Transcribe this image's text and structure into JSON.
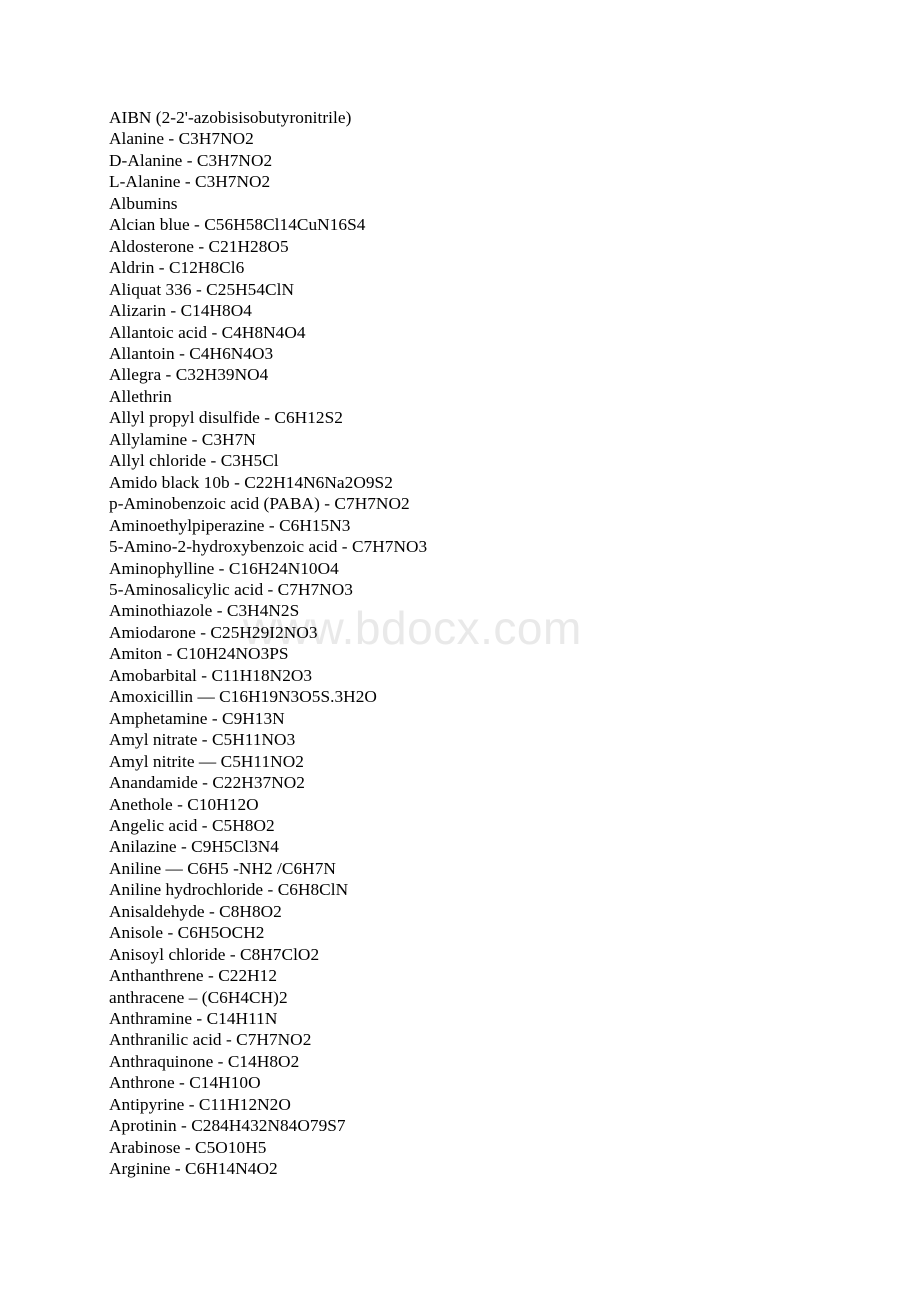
{
  "document": {
    "title": "Chemical compounds list - A entries",
    "background_color": "#ffffff",
    "text_color": "#000000"
  },
  "watermark": {
    "text": "www.bdocx.com",
    "color": "#e9e9e9"
  },
  "entries": [
    {
      "name": "AIBN",
      "formula": "",
      "separator": "",
      "text": "AIBN (2-2'-azobisisobutyronitrile)"
    },
    {
      "name": "Alanine",
      "formula": "C3H7NO2",
      "separator": "-",
      "text": "Alanine - C3H7NO2"
    },
    {
      "name": "D-Alanine",
      "formula": "C3H7NO2",
      "separator": "-",
      "text": "D-Alanine - C3H7NO2"
    },
    {
      "name": "L-Alanine",
      "formula": "C3H7NO2",
      "separator": "-",
      "text": "L-Alanine - C3H7NO2"
    },
    {
      "name": "Albumins",
      "formula": "",
      "separator": "",
      "text": "Albumins"
    },
    {
      "name": "Alcian blue",
      "formula": "C56H58Cl14CuN16S4",
      "separator": "-",
      "text": "Alcian blue - C56H58Cl14CuN16S4"
    },
    {
      "name": "Aldosterone",
      "formula": "C21H28O5",
      "separator": "-",
      "text": "Aldosterone - C21H28O5"
    },
    {
      "name": "Aldrin",
      "formula": "C12H8Cl6",
      "separator": "-",
      "text": "Aldrin - C12H8Cl6"
    },
    {
      "name": "Aliquat 336",
      "formula": "C25H54ClN",
      "separator": "-",
      "text": "Aliquat 336 - C25H54ClN"
    },
    {
      "name": "Alizarin",
      "formula": "C14H8O4",
      "separator": "-",
      "text": "Alizarin - C14H8O4"
    },
    {
      "name": "Allantoic acid",
      "formula": "C4H8N4O4",
      "separator": "-",
      "text": "Allantoic acid - C4H8N4O4"
    },
    {
      "name": "Allantoin",
      "formula": "C4H6N4O3",
      "separator": "-",
      "text": "Allantoin - C4H6N4O3"
    },
    {
      "name": "Allegra",
      "formula": "C32H39NO4",
      "separator": "-",
      "text": "Allegra - C32H39NO4"
    },
    {
      "name": "Allethrin",
      "formula": "",
      "separator": "",
      "text": "Allethrin"
    },
    {
      "name": "Allyl propyl disulfide",
      "formula": "C6H12S2",
      "separator": "-",
      "text": "Allyl propyl disulfide - C6H12S2"
    },
    {
      "name": "Allylamine",
      "formula": "C3H7N",
      "separator": "-",
      "text": "Allylamine - C3H7N"
    },
    {
      "name": "Allyl chloride",
      "formula": "C3H5Cl",
      "separator": "-",
      "text": "Allyl chloride - C3H5Cl"
    },
    {
      "name": "Amido black 10b",
      "formula": "C22H14N6Na2O9S2",
      "separator": "-",
      "text": "Amido black 10b - C22H14N6Na2O9S2"
    },
    {
      "name": "p-Aminobenzoic acid (PABA)",
      "formula": "C7H7NO2",
      "separator": "-",
      "text": "p-Aminobenzoic acid (PABA) - C7H7NO2"
    },
    {
      "name": "Aminoethylpiperazine",
      "formula": "C6H15N3",
      "separator": "-",
      "text": "Aminoethylpiperazine - C6H15N3"
    },
    {
      "name": "5-Amino-2-hydroxybenzoic acid",
      "formula": "C7H7NO3",
      "separator": "-",
      "text": "5-Amino-2-hydroxybenzoic acid - C7H7NO3"
    },
    {
      "name": "Aminophylline",
      "formula": "C16H24N10O4",
      "separator": "-",
      "text": "Aminophylline - C16H24N10O4"
    },
    {
      "name": "5-Aminosalicylic acid",
      "formula": "C7H7NO3",
      "separator": "-",
      "text": "5-Aminosalicylic acid - C7H7NO3"
    },
    {
      "name": "Aminothiazole",
      "formula": "C3H4N2S",
      "separator": "-",
      "text": "Aminothiazole - C3H4N2S"
    },
    {
      "name": "Amiodarone",
      "formula": "C25H29I2NO3",
      "separator": "-",
      "text": "Amiodarone - C25H29I2NO3"
    },
    {
      "name": "Amiton",
      "formula": "C10H24NO3PS",
      "separator": "-",
      "text": "Amiton - C10H24NO3PS"
    },
    {
      "name": "Amobarbital",
      "formula": "C11H18N2O3",
      "separator": "-",
      "text": "Amobarbital - C11H18N2O3"
    },
    {
      "name": "Amoxicillin",
      "formula": "C16H19N3O5S.3H2O",
      "separator": "—",
      "text": "Amoxicillin — C16H19N3O5S.3H2O"
    },
    {
      "name": "Amphetamine",
      "formula": "C9H13N",
      "separator": "-",
      "text": "Amphetamine - C9H13N"
    },
    {
      "name": "Amyl nitrate",
      "formula": "C5H11NO3",
      "separator": "-",
      "text": "Amyl nitrate - C5H11NO3"
    },
    {
      "name": "Amyl nitrite",
      "formula": "C5H11NO2",
      "separator": "—",
      "text": "Amyl nitrite — C5H11NO2"
    },
    {
      "name": "Anandamide",
      "formula": "C22H37NO2",
      "separator": "-",
      "text": "Anandamide - C22H37NO2"
    },
    {
      "name": "Anethole",
      "formula": "C10H12O",
      "separator": "-",
      "text": "Anethole - C10H12O"
    },
    {
      "name": "Angelic acid",
      "formula": "C5H8O2",
      "separator": "-",
      "text": "Angelic acid - C5H8O2"
    },
    {
      "name": "Anilazine",
      "formula": "C9H5Cl3N4",
      "separator": "-",
      "text": "Anilazine - C9H5Cl3N4"
    },
    {
      "name": "Aniline",
      "formula": "C6H5 -NH2 /C6H7N",
      "separator": "—",
      "text": "Aniline — C6H5 -NH2 /C6H7N"
    },
    {
      "name": "Aniline hydrochloride",
      "formula": "C6H8ClN",
      "separator": "-",
      "text": "Aniline hydrochloride - C6H8ClN"
    },
    {
      "name": "Anisaldehyde",
      "formula": "C8H8O2",
      "separator": "-",
      "text": "Anisaldehyde - C8H8O2"
    },
    {
      "name": "Anisole",
      "formula": "C6H5OCH2",
      "separator": "-",
      "text": "Anisole - C6H5OCH2"
    },
    {
      "name": "Anisoyl chloride",
      "formula": "C8H7ClO2",
      "separator": "-",
      "text": "Anisoyl chloride - C8H7ClO2"
    },
    {
      "name": "Anthanthrene",
      "formula": "C22H12",
      "separator": "-",
      "text": "Anthanthrene - C22H12"
    },
    {
      "name": "anthracene",
      "formula": "(C6H4CH)2",
      "separator": "–",
      "text": "anthracene – (C6H4CH)2"
    },
    {
      "name": "Anthramine",
      "formula": "C14H11N",
      "separator": "-",
      "text": "Anthramine - C14H11N"
    },
    {
      "name": "Anthranilic acid",
      "formula": "C7H7NO2",
      "separator": "-",
      "text": "Anthranilic acid - C7H7NO2"
    },
    {
      "name": "Anthraquinone",
      "formula": "C14H8O2",
      "separator": "-",
      "text": "Anthraquinone - C14H8O2"
    },
    {
      "name": "Anthrone",
      "formula": "C14H10O",
      "separator": "-",
      "text": "Anthrone - C14H10O"
    },
    {
      "name": "Antipyrine",
      "formula": "C11H12N2O",
      "separator": "-",
      "text": "Antipyrine - C11H12N2O"
    },
    {
      "name": "Aprotinin",
      "formula": "C284H432N84O79S7",
      "separator": "-",
      "text": "Aprotinin - C284H432N84O79S7"
    },
    {
      "name": "Arabinose",
      "formula": "C5O10H5",
      "separator": "-",
      "text": "Arabinose - C5O10H5"
    },
    {
      "name": "Arginine",
      "formula": "C6H14N4O2",
      "separator": "-",
      "text": "Arginine - C6H14N4O2"
    }
  ]
}
